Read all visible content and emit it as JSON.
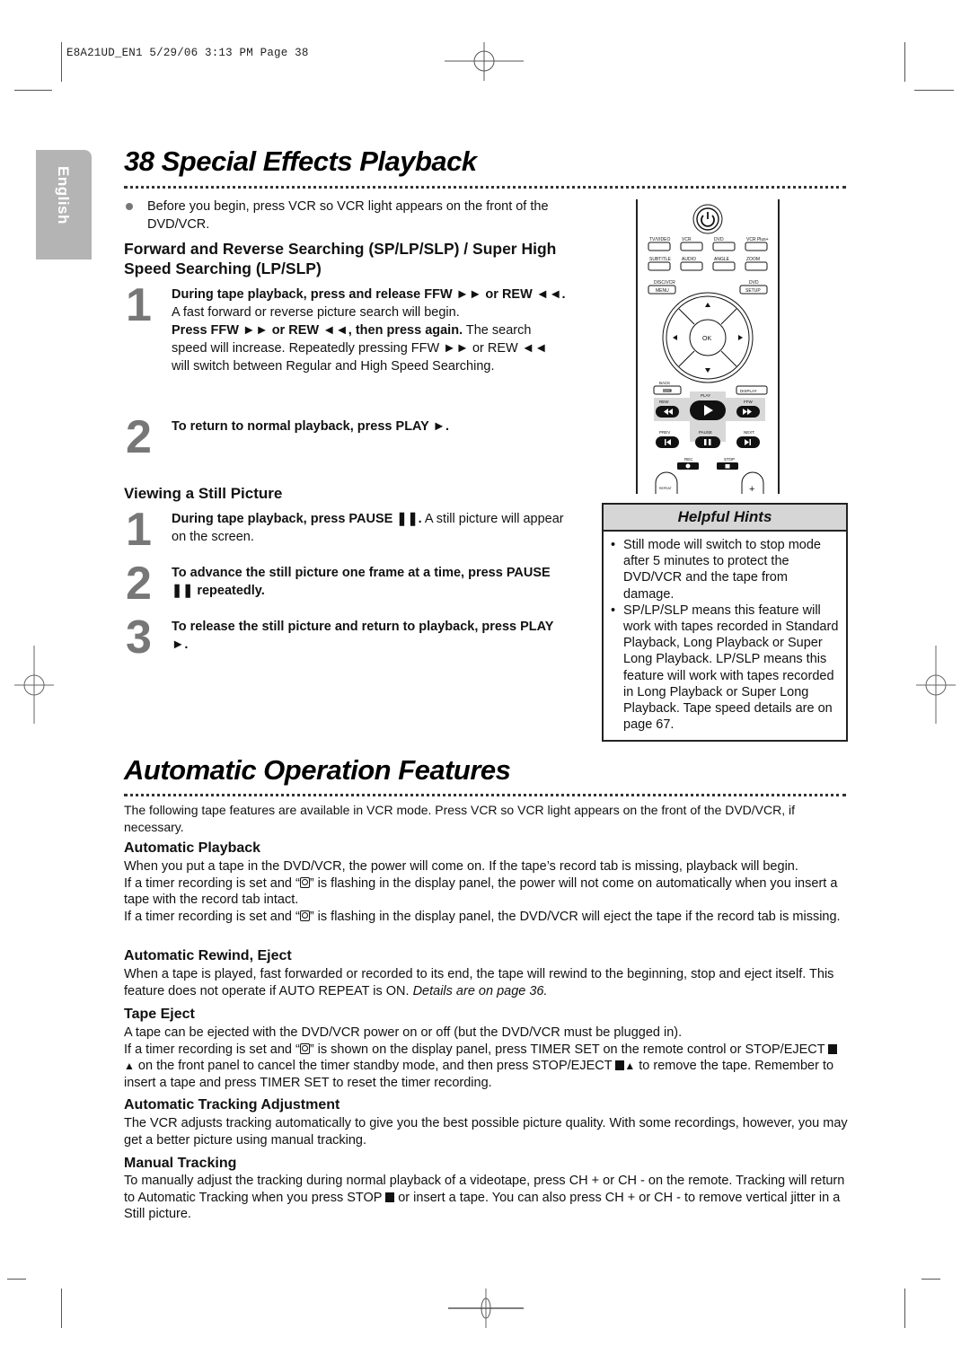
{
  "slug": "E8A21UD_EN1  5/29/06  3:13 PM  Page 38",
  "language_tab": "English",
  "section1": {
    "title": "38  Special Effects Playback",
    "intro_bullet": "Before you begin, press VCR so VCR light appears on the front of the DVD/VCR.",
    "heading1": "Forward and Reverse Searching (SP/LP/SLP) / Super High Speed Searching (LP/SLP)",
    "search_steps": [
      {
        "num": "1",
        "bold1": "During tape playback, press and release FFW ►► or REW ◄◄.",
        "text1": " A fast forward or reverse picture search will begin.",
        "bold2": "Press FFW ►► or REW ◄◄, then press again.",
        "text2": " The search speed will increase. Repeatedly pressing FFW ►► or REW ◄◄ will switch between Regular and High Speed Searching."
      },
      {
        "num": "2",
        "bold1": "To return to normal playback, press PLAY ►.",
        "text1": ""
      }
    ],
    "heading2": "Viewing a Still Picture",
    "still_steps": [
      {
        "num": "1",
        "bold1": "During tape playback, press PAUSE ❚❚.",
        "text1": " A still picture will appear on the screen."
      },
      {
        "num": "2",
        "bold1": "To advance the still picture one frame at a time, press PAUSE ❚❚ repeatedly.",
        "text1": ""
      },
      {
        "num": "3",
        "bold1": "To release the still picture and return to playback, press PLAY ►.",
        "text1": ""
      }
    ]
  },
  "remote": {
    "row1": [
      "TV/VIDEO",
      "VCR",
      "DVD",
      "VCR Plus+"
    ],
    "row2": [
      "SUBTITLE",
      "AUDIO",
      "ANGLE",
      "ZOOM"
    ],
    "menu_top": "DISC/VCR",
    "menu_label": "MENU",
    "setup_top": "DVD",
    "setup_label": "SETUP",
    "ok": "OK",
    "back": "BACK",
    "display": "DISPLAY",
    "play": "PLAY",
    "rew": "REW",
    "ffw": "FFW",
    "prev": "PREV",
    "pause": "PAUSE",
    "next": "NEXT",
    "rec": "REC",
    "stop": "STOP",
    "repeat": "REPEAT",
    "plus": "+"
  },
  "hints": {
    "title": "Helpful Hints",
    "items": [
      "Still mode will switch to stop mode after 5 minutes to protect the DVD/VCR and the tape from damage.",
      "SP/LP/SLP means this feature will work with tapes recorded in Standard Playback, Long Playback or Super Long Playback. LP/SLP means this feature will work with tapes recorded in Long Playback or Super Long Playback. Tape speed details are on page 67."
    ]
  },
  "section2": {
    "title": "Automatic Operation Features",
    "intro": "The following tape features are available in VCR mode. Press VCR so VCR light appears on the front of the DVD/VCR, if necessary.",
    "auto_playback": {
      "heading": "Automatic Playback",
      "p1": "When you put a tape in the DVD/VCR, the power will come on. If the tape’s record tab is missing, playback will begin.",
      "p2a": "If a timer recording is set and “",
      "p2b": "” is flashing in the display panel, the power will not come on automatically when you insert a tape with the record tab intact.",
      "p3a": "If a timer recording is set and “",
      "p3b": "” is flashing in the display panel, the DVD/VCR will eject the tape if the record tab is missing."
    },
    "auto_rewind": {
      "heading": "Automatic Rewind, Eject",
      "p1": "When a tape is played, fast forwarded or recorded to its end, the tape will rewind to the beginning, stop and eject itself. This feature does not operate if AUTO REPEAT is ON. ",
      "p1_italic": "Details are on page 36."
    },
    "tape_eject": {
      "heading": "Tape Eject",
      "p1": "A tape can be ejected with the DVD/VCR power on or off (but the DVD/VCR must be plugged in).",
      "p2a": "If a timer recording is set and “",
      "p2b": "” is shown on the display panel, press TIMER SET on the remote control or STOP/EJECT ",
      "p2c": " on the front panel to cancel the timer standby mode, and then press STOP/EJECT ",
      "p2d": " to remove the tape. Remember to insert a tape and press TIMER SET to reset the timer recording."
    },
    "auto_tracking": {
      "heading": "Automatic Tracking Adjustment",
      "p1": "The VCR adjusts tracking automatically to give you the best possible picture quality. With some recordings, however, you may get a better picture using manual tracking."
    },
    "manual_tracking": {
      "heading": "Manual Tracking",
      "p1a": "To manually adjust the tracking during normal playback of a videotape, press CH + or CH - on the remote. Tracking will return to Automatic Tracking when you press STOP ",
      "p1b": " or insert a tape. You can also press CH + or CH - to remove vertical jitter in a Still picture."
    }
  }
}
